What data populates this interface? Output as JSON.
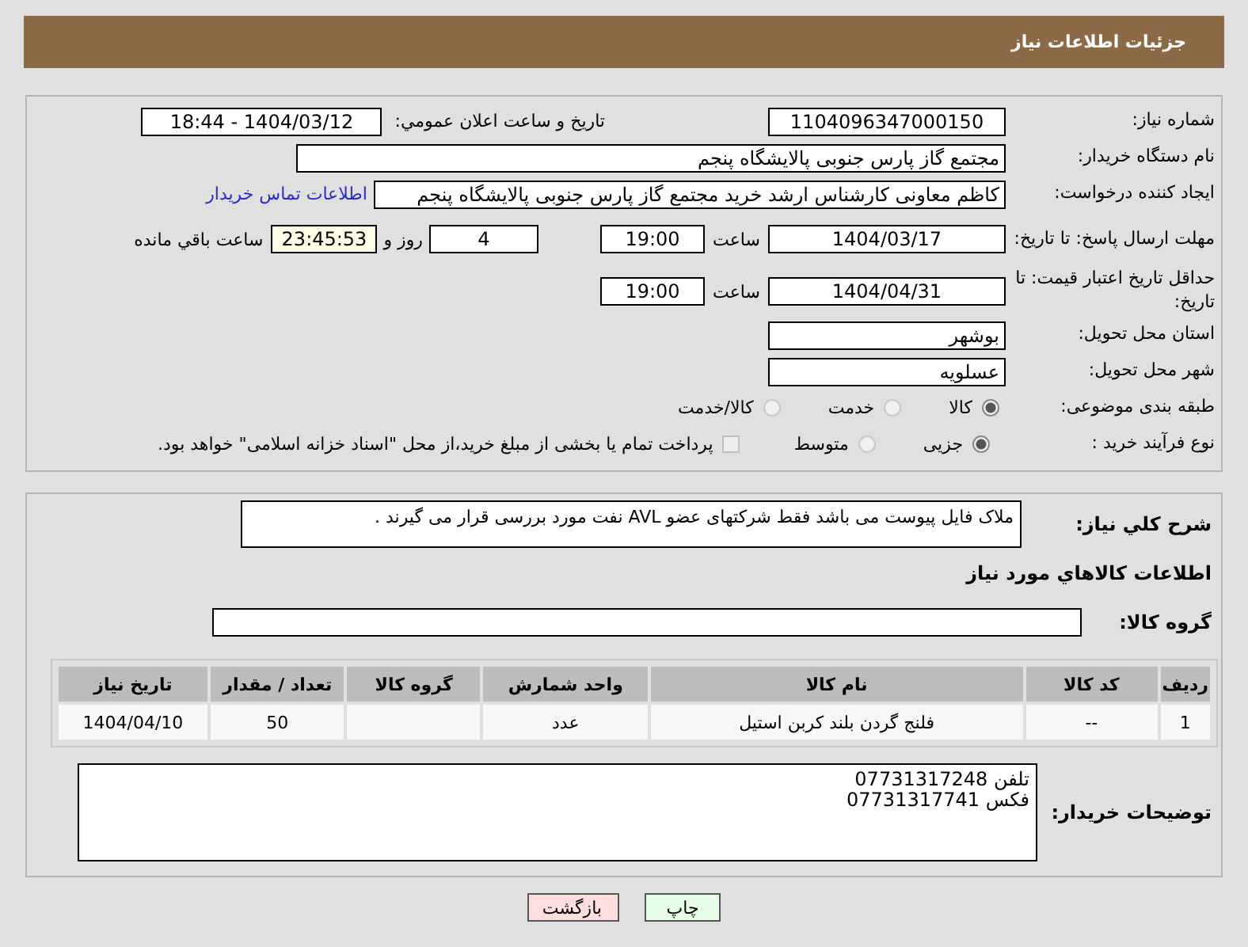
{
  "header": {
    "title": "جزئیات اطلاعات نیاز"
  },
  "need_number": {
    "label": "شماره نیاز:",
    "value": "1104096347000150"
  },
  "announce": {
    "label": "تاریخ و ساعت اعلان عمومي:",
    "value": "1404/03/12 - 18:44"
  },
  "buyer_org": {
    "label": "نام دستگاه خریدار:",
    "value": "مجتمع گاز پارس جنوبی  پالایشگاه پنجم"
  },
  "requester": {
    "label": "ایجاد کننده درخواست:",
    "value": "کاظم معاونی کارشناس ارشد خرید مجتمع گاز پارس جنوبی  پالایشگاه پنجم",
    "contact_link": "اطلاعات تماس خریدار"
  },
  "reply_deadline": {
    "label": "مهلت ارسال پاسخ: تا تاریخ:",
    "date": "1404/03/17",
    "time_label": "ساعت",
    "time": "19:00",
    "days": "4",
    "days_label": "روز و",
    "remaining": "23:45:53",
    "remaining_label": "ساعت باقي مانده"
  },
  "price_validity": {
    "label": "حداقل تاریخ اعتبار قیمت: تا تاریخ:",
    "date": "1404/04/31",
    "time_label": "ساعت",
    "time": "19:00"
  },
  "province": {
    "label": "استان محل تحویل:",
    "value": "بوشهر"
  },
  "city": {
    "label": "شهر محل تحویل:",
    "value": "عسلویه"
  },
  "category": {
    "label": "طبقه بندی موضوعی:",
    "options": [
      {
        "label": "کالا",
        "selected": true
      },
      {
        "label": "خدمت",
        "selected": false
      },
      {
        "label": "کالا/خدمت",
        "selected": false
      }
    ]
  },
  "process": {
    "label": "نوع فرآیند خرید :",
    "options": [
      {
        "label": "جزیی",
        "selected": true
      },
      {
        "label": "متوسط",
        "selected": false
      }
    ],
    "treasury": {
      "label": "پرداخت تمام یا بخشی از مبلغ خرید،از محل \"اسناد خزانه اسلامی\" خواهد بود.",
      "checked": false
    }
  },
  "description": {
    "label": "شرح کلي نیاز:",
    "value": "ملاک فایل پیوست می باشد فقط شرکتهای عضو AVL نفت مورد بررسی قرار می گیرند ."
  },
  "goods_title": "اطلاعات کالاهاي مورد نیاز",
  "goods_group": {
    "label": "گروه کالا:"
  },
  "table": {
    "columns": [
      "ردیف",
      "کد کالا",
      "نام کالا",
      "واحد شمارش",
      "گروه کالا",
      "تعداد / مقدار",
      "تاریخ نیاز"
    ],
    "rows": [
      {
        "index": "1",
        "code": "--",
        "name": "فلنج گردن بلند کربن استیل",
        "unit": "عدد",
        "quantity": "50",
        "date": "1404/04/10"
      }
    ]
  },
  "buyer_notes": {
    "label": "توضیحات خریدار:",
    "lines": [
      "تلفن 07731317248",
      "فکس 07731317741"
    ]
  },
  "buttons": [
    {
      "label": "چاپ",
      "kind": "print"
    },
    {
      "label": "بازگشت",
      "kind": "back"
    }
  ]
}
